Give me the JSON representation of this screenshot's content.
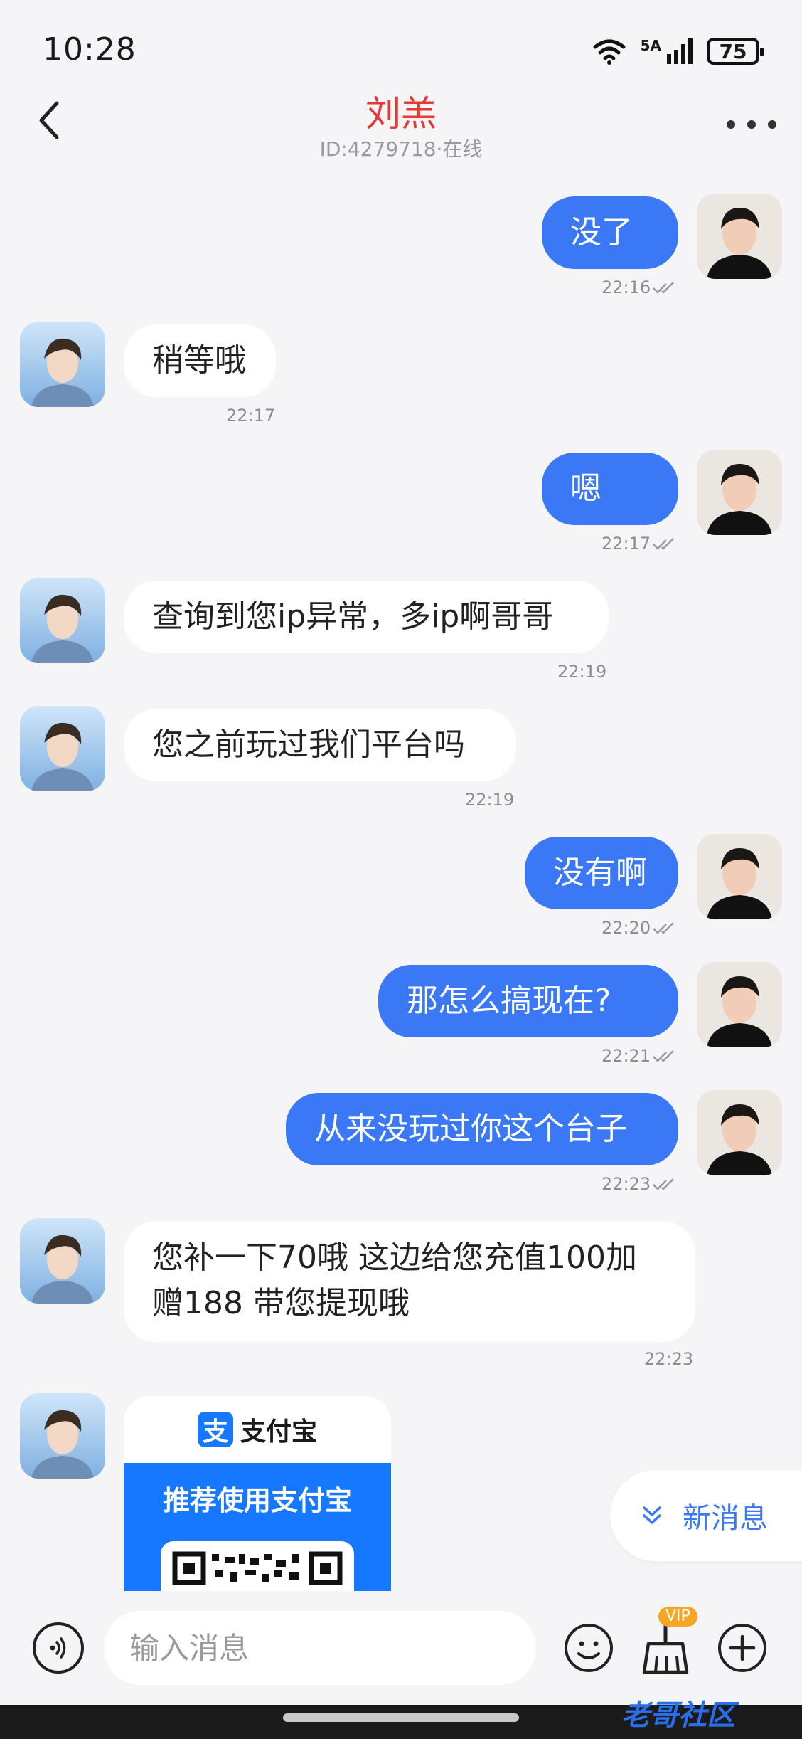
{
  "status": {
    "time": "10:28",
    "battery": "75",
    "network": "5A"
  },
  "header": {
    "title": "刘羔",
    "subtitle": "ID:4279718·在线"
  },
  "messages": [
    {
      "side": "out",
      "text": "没了",
      "time": "22:16"
    },
    {
      "side": "in",
      "text": "稍等哦",
      "time": "22:17"
    },
    {
      "side": "out",
      "text": "嗯",
      "time": "22:17"
    },
    {
      "side": "in",
      "text": "查询到您ip异常，多ip啊哥哥",
      "time": "22:19"
    },
    {
      "side": "in",
      "text": "您之前玩过我们平台吗",
      "time": "22:19"
    },
    {
      "side": "out",
      "text": "没有啊",
      "time": "22:20"
    },
    {
      "side": "out",
      "text": "那怎么搞现在?",
      "time": "22:21"
    },
    {
      "side": "out",
      "text": "从来没玩过你这个台子",
      "time": "22:23"
    },
    {
      "side": "in",
      "text_line1": "您补一下70哦 这边给您充值100加",
      "text_line2": "赠188 带您提现哦",
      "time": "22:23"
    }
  ],
  "alipay_card": {
    "brand": "支付宝",
    "logo_char": "支",
    "banner": "推荐使用支付宝"
  },
  "new_message_pill": {
    "label": "新消息"
  },
  "composer": {
    "placeholder": "输入消息",
    "vip_badge": "VIP"
  },
  "watermark": "老哥社区",
  "colors": {
    "accent": "#3b78f5",
    "title_red": "#e53935",
    "alipay_blue": "#1677ff"
  }
}
